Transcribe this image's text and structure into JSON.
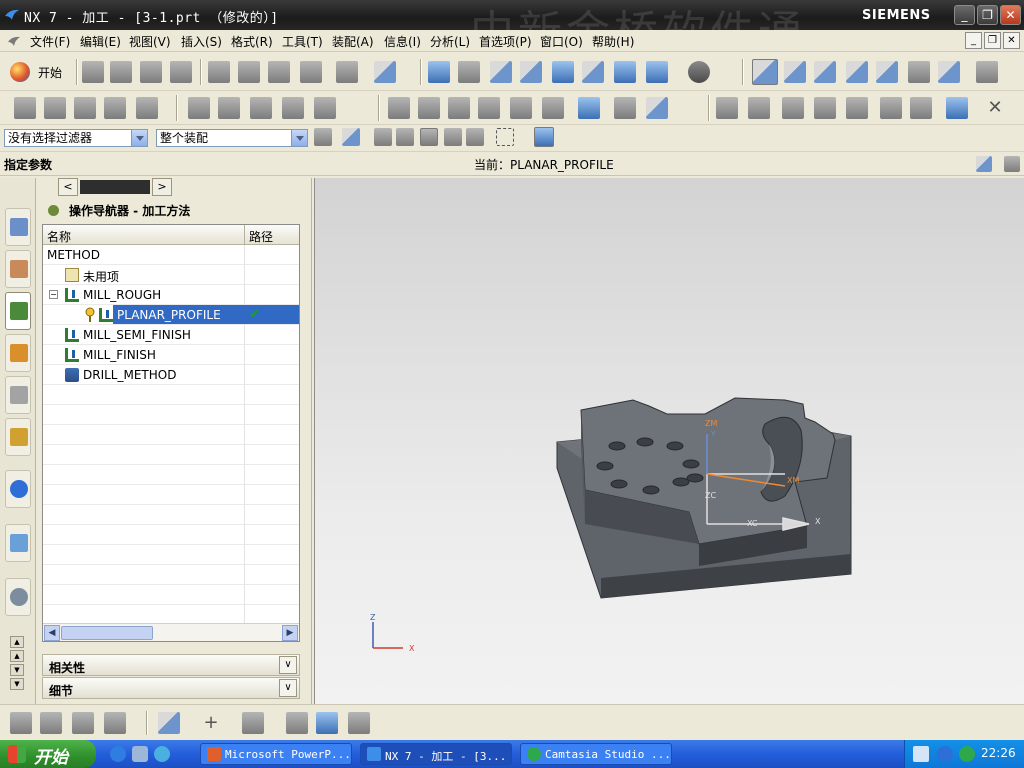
{
  "window": {
    "title": "NX 7 - 加工 - [3-1.prt （修改的）]",
    "watermark": "中新金桥软件通",
    "brand": "SIEMENS",
    "controls": {
      "minimize": "_",
      "restore": "❐",
      "close": "✕"
    }
  },
  "menubar": {
    "items": [
      "文件(F)",
      "编辑(E)",
      "视图(V)",
      "插入(S)",
      "格式(R)",
      "工具(T)",
      "装配(A)",
      "信息(I)",
      "分析(L)",
      "首选项(P)",
      "窗口(O)",
      "帮助(H)"
    ],
    "mdi_controls": {
      "minimize": "_",
      "restore": "❐",
      "close": "✕"
    }
  },
  "toolbar": {
    "start_label": "开始",
    "selection_filter": "没有选择过滤器",
    "assembly_scope": "整个装配"
  },
  "cue": {
    "prompt": "指定参数",
    "status": "当前：PLANAR_PROFILE"
  },
  "navigator": {
    "title": "操作导航器 - 加工方法",
    "columns": {
      "name": "名称",
      "path": "路径"
    },
    "rows": [
      {
        "label": "METHOD"
      },
      {
        "label": "未用项"
      },
      {
        "label": "MILL_ROUGH",
        "expander": "−"
      },
      {
        "label": "PLANAR_PROFILE",
        "path": "✔"
      },
      {
        "label": "MILL_SEMI_FINISH"
      },
      {
        "label": "MILL_FINISH"
      },
      {
        "label": "DRILL_METHOD"
      }
    ],
    "sections": {
      "relations": "相关性",
      "details": "细节"
    },
    "chevron": "∨"
  },
  "triad": {
    "view_z": "Z",
    "view_x": "X",
    "wcs_zm": "ZM",
    "wcs_xm": "XM",
    "wcs_zc": "ZC",
    "wcs_xc": "XC",
    "wcs_x": "X",
    "wcs_y": "Y"
  },
  "taskbar": {
    "start_label": "开始",
    "tasks": [
      {
        "label": "Microsoft PowerP..."
      },
      {
        "label": "NX 7 - 加工 - [3..."
      },
      {
        "label": "Camtasia Studio ..."
      }
    ],
    "clock": "22:26"
  },
  "colors": {
    "selection": "#316ac5",
    "check": "#1f9b2b",
    "taskbar": "#245edb",
    "start": "#2f8f2b"
  }
}
